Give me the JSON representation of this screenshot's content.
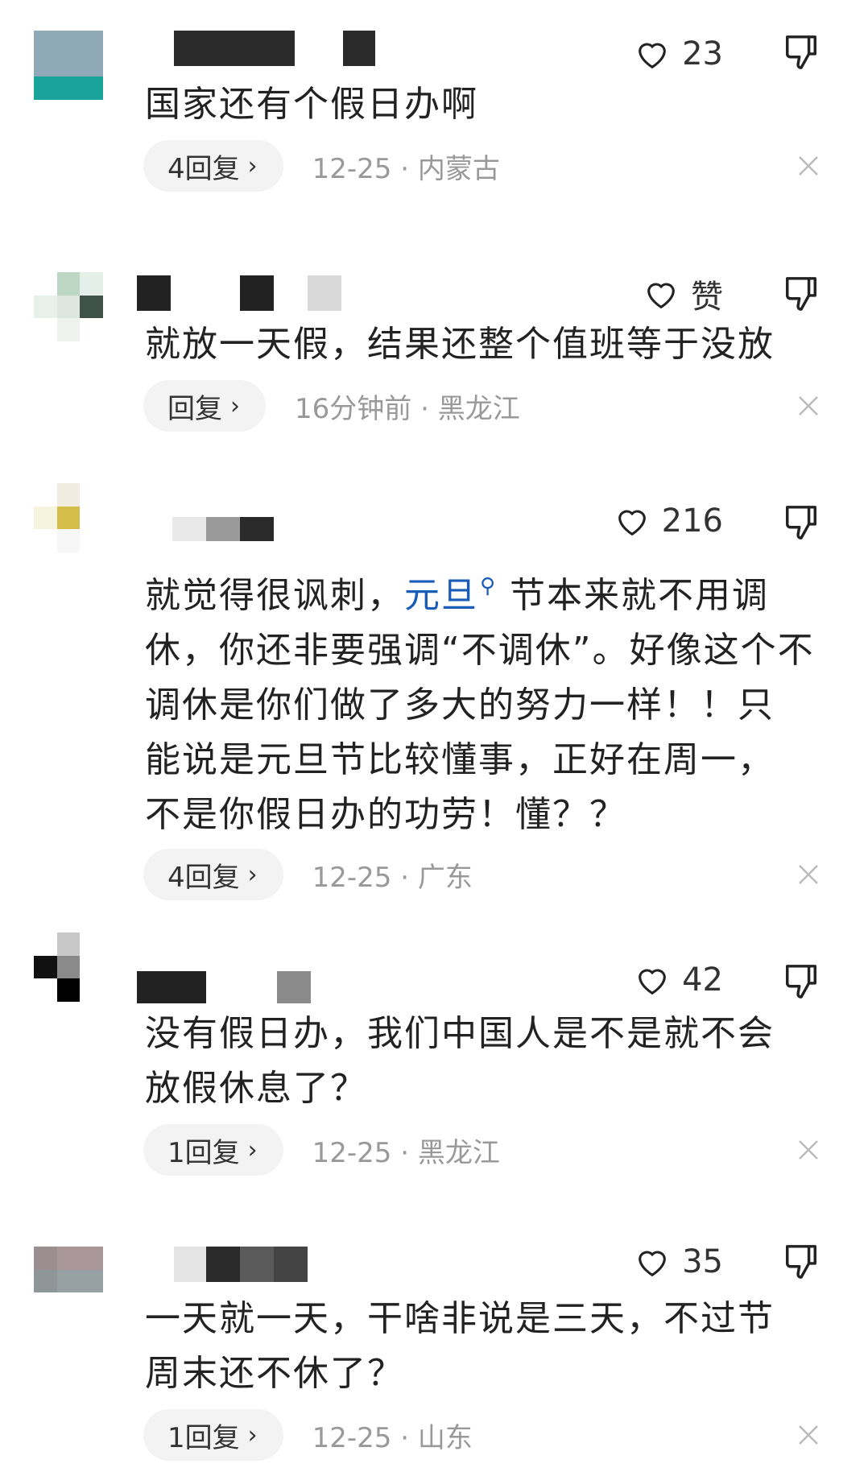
{
  "comments": [
    {
      "likes": "23",
      "text_lines": [
        "国家还有个假日办啊"
      ],
      "reply_label": "4回复",
      "date": "12-25",
      "location": "内蒙古",
      "avatar_colors": [
        "#8fa9b8",
        "#8fa9b8",
        "#8fa9b8",
        "#8fa9b8",
        "#8fa9b8",
        "#8fa9b8",
        "#1aa39a",
        "#1aa39a",
        "#1aa39a"
      ]
    },
    {
      "likes": "赞",
      "text_lines": [
        "就放一天假，结果还整个值班等于没放"
      ],
      "reply_label": "回复",
      "date": "16分钟前",
      "location": "黑龙江",
      "avatar_colors": [
        "#ffffff",
        "#bcd8c4",
        "#e4efe9",
        "#e8f0ea",
        "#dde6e0",
        "#3f5248",
        "#ffffff",
        "#eef2ef",
        "#ffffff"
      ]
    },
    {
      "likes": "216",
      "text_lines": [
        "就觉得很讽刺，",
        "休，你还非要强调“不调休”。好像这个不",
        "调休是你们做了多大的努力一样！！只",
        "能说是元旦节比较懂事，正好在周一，",
        "不是你假日办的功劳！懂？？"
      ],
      "highlight": "元旦",
      "after_highlight": "节本来就不用调",
      "reply_label": "4回复",
      "date": "12-25",
      "location": "广东",
      "avatar_colors": [
        "#ffffff",
        "#f0ece0",
        "#ffffff",
        "#f6f3df",
        "#d5bd4c",
        "#ffffff",
        "#ffffff",
        "#f7f7f7",
        "#ffffff"
      ]
    },
    {
      "likes": "42",
      "text_lines": [
        "没有假日办，我们中国人是不是就不会",
        "放假休息了？"
      ],
      "reply_label": "1回复",
      "date": "12-25",
      "location": "黑龙江",
      "avatar_colors": [
        "#ffffff",
        "#c8c8c8",
        "#ffffff",
        "#111111",
        "#8a8a8a",
        "#ffffff",
        "#ffffff",
        "#000000",
        "#ffffff"
      ]
    },
    {
      "likes": "35",
      "text_lines": [
        "一天就一天，干啥非说是三天，不过节",
        "周末还不休了？"
      ],
      "reply_label": "1回复",
      "date": "12-25",
      "location": "山东",
      "avatar_colors": [
        "#9a8e90",
        "#a89698",
        "#a89698",
        "#8f9698",
        "#97a0a2",
        "#97a0a2",
        "#ffffff",
        "#ffffff",
        "#ffffff"
      ]
    }
  ],
  "colors": {
    "text": "#222222",
    "meta": "#999999",
    "link": "#1a5db8",
    "pill": "#f3f3f3"
  }
}
